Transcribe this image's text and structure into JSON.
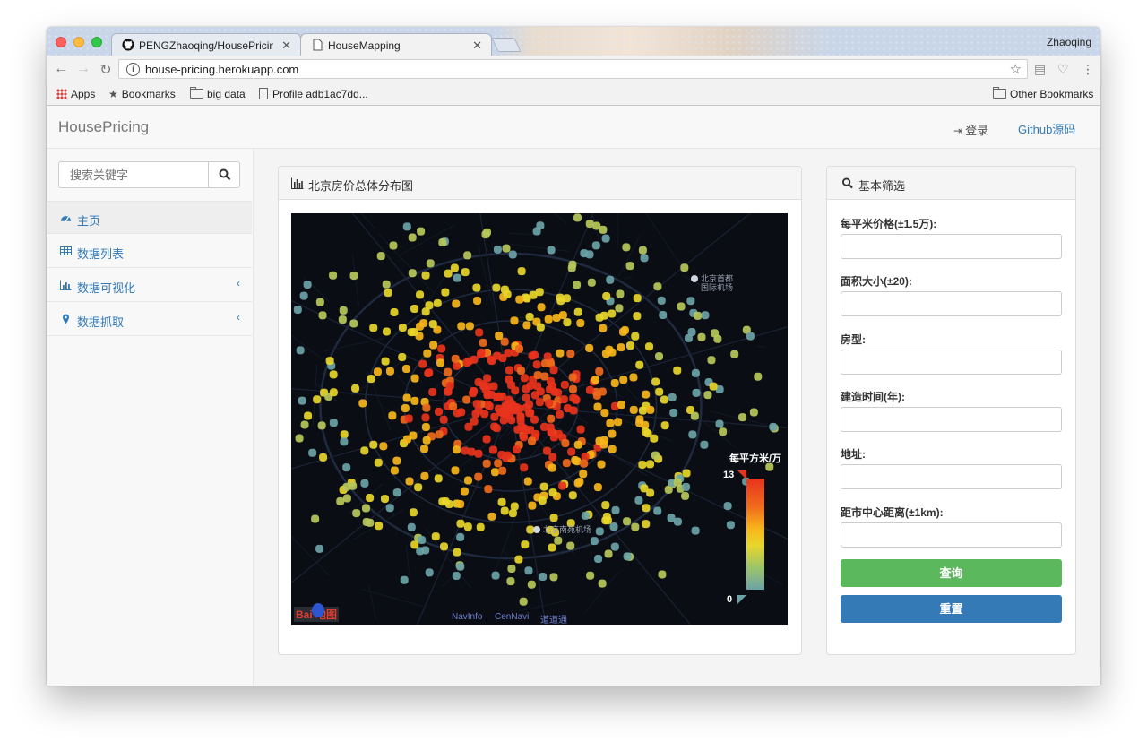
{
  "browser": {
    "user_name": "Zhaoqing",
    "tabs": [
      {
        "title": "PENGZhaoqing/HousePricing",
        "icon": "github-icon"
      },
      {
        "title": "HouseMapping",
        "icon": "document-icon"
      }
    ],
    "url": "house-pricing.herokuapp.com",
    "bookmarks": {
      "apps": "Apps",
      "bookmarks": "Bookmarks",
      "big_data": "big data",
      "profile": "Profile adb1ac7dd...",
      "other": "Other Bookmarks"
    }
  },
  "app": {
    "brand": "HousePricing",
    "nav_login": "登录",
    "nav_github": "Github源码"
  },
  "sidebar": {
    "search_placeholder": "搜索关键字",
    "items": [
      {
        "label": "主页",
        "icon": "dashboard-icon",
        "active": true
      },
      {
        "label": "数据列表",
        "icon": "table-icon"
      },
      {
        "label": "数据可视化",
        "icon": "bar-chart-icon",
        "expandable": true
      },
      {
        "label": "数据抓取",
        "icon": "map-marker-icon",
        "expandable": true
      }
    ]
  },
  "map_panel": {
    "title": "北京房价总体分布图",
    "legend_title": "每平方米/万",
    "legend_max": "13",
    "legend_min": "0",
    "legend_colors": [
      "#e8331c",
      "#f7b51a",
      "#e8d62a",
      "#6ba3a8"
    ],
    "labels": {
      "airport_capital_line1": "北京首都",
      "airport_capital_line2": "国际机场",
      "airport_nanyuan": "北京南苑机场"
    },
    "attribution": {
      "navinfo": "NavInfo",
      "cennavi": "CenNavi",
      "daodaotong": "道道通"
    },
    "baidu_logo": "Bai 地图"
  },
  "filter_panel": {
    "title": "基本筛选",
    "fields": [
      {
        "label": "每平米价格(±1.5万):",
        "value": ""
      },
      {
        "label": "面积大小(±20):",
        "value": ""
      },
      {
        "label": "房型:",
        "value": ""
      },
      {
        "label": "建造时间(年):",
        "value": ""
      },
      {
        "label": "地址:",
        "value": ""
      },
      {
        "label": "距市中心距离(±1km):",
        "value": ""
      }
    ],
    "query_button": "查询",
    "reset_button": "重置",
    "query_color": "#5cb85c",
    "reset_color": "#337ab7"
  }
}
